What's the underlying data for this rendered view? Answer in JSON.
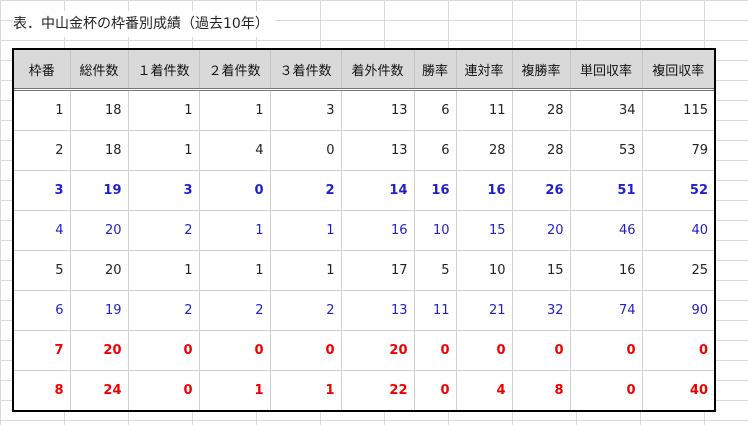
{
  "caption": "表．中山金杯の枠番別成績（過去10年）",
  "table": {
    "headers": [
      "枠番",
      "総件数",
      "１着件数",
      "２着件数",
      "３着件数",
      "着外件数",
      "勝率",
      "連対率",
      "複勝率",
      "単回収率",
      "複回収率"
    ],
    "rows": [
      {
        "style": "black",
        "cells": [
          "1",
          "18",
          "1",
          "1",
          "3",
          "13",
          "6",
          "11",
          "28",
          "34",
          "115"
        ]
      },
      {
        "style": "black",
        "cells": [
          "2",
          "18",
          "1",
          "4",
          "0",
          "13",
          "6",
          "28",
          "28",
          "53",
          "79"
        ]
      },
      {
        "style": "bold-blue",
        "cells": [
          "3",
          "19",
          "3",
          "0",
          "2",
          "14",
          "16",
          "16",
          "26",
          "51",
          "52"
        ]
      },
      {
        "style": "blue",
        "cells": [
          "4",
          "20",
          "2",
          "1",
          "1",
          "16",
          "10",
          "15",
          "20",
          "46",
          "40"
        ]
      },
      {
        "style": "black",
        "cells": [
          "5",
          "20",
          "1",
          "1",
          "1",
          "17",
          "5",
          "10",
          "15",
          "16",
          "25"
        ]
      },
      {
        "style": "blue",
        "cells": [
          "6",
          "19",
          "2",
          "2",
          "2",
          "13",
          "11",
          "21",
          "32",
          "74",
          "90"
        ]
      },
      {
        "style": "bold-red",
        "cells": [
          "7",
          "20",
          "0",
          "0",
          "0",
          "20",
          "0",
          "0",
          "0",
          "0",
          "0"
        ]
      },
      {
        "style": "bold-red",
        "cells": [
          "8",
          "24",
          "0",
          "1",
          "1",
          "22",
          "0",
          "4",
          "8",
          "0",
          "40"
        ]
      }
    ]
  },
  "colors": {
    "blue": "#1f1fc9",
    "red": "#f00000",
    "header_bg": "#d9d9d9"
  }
}
